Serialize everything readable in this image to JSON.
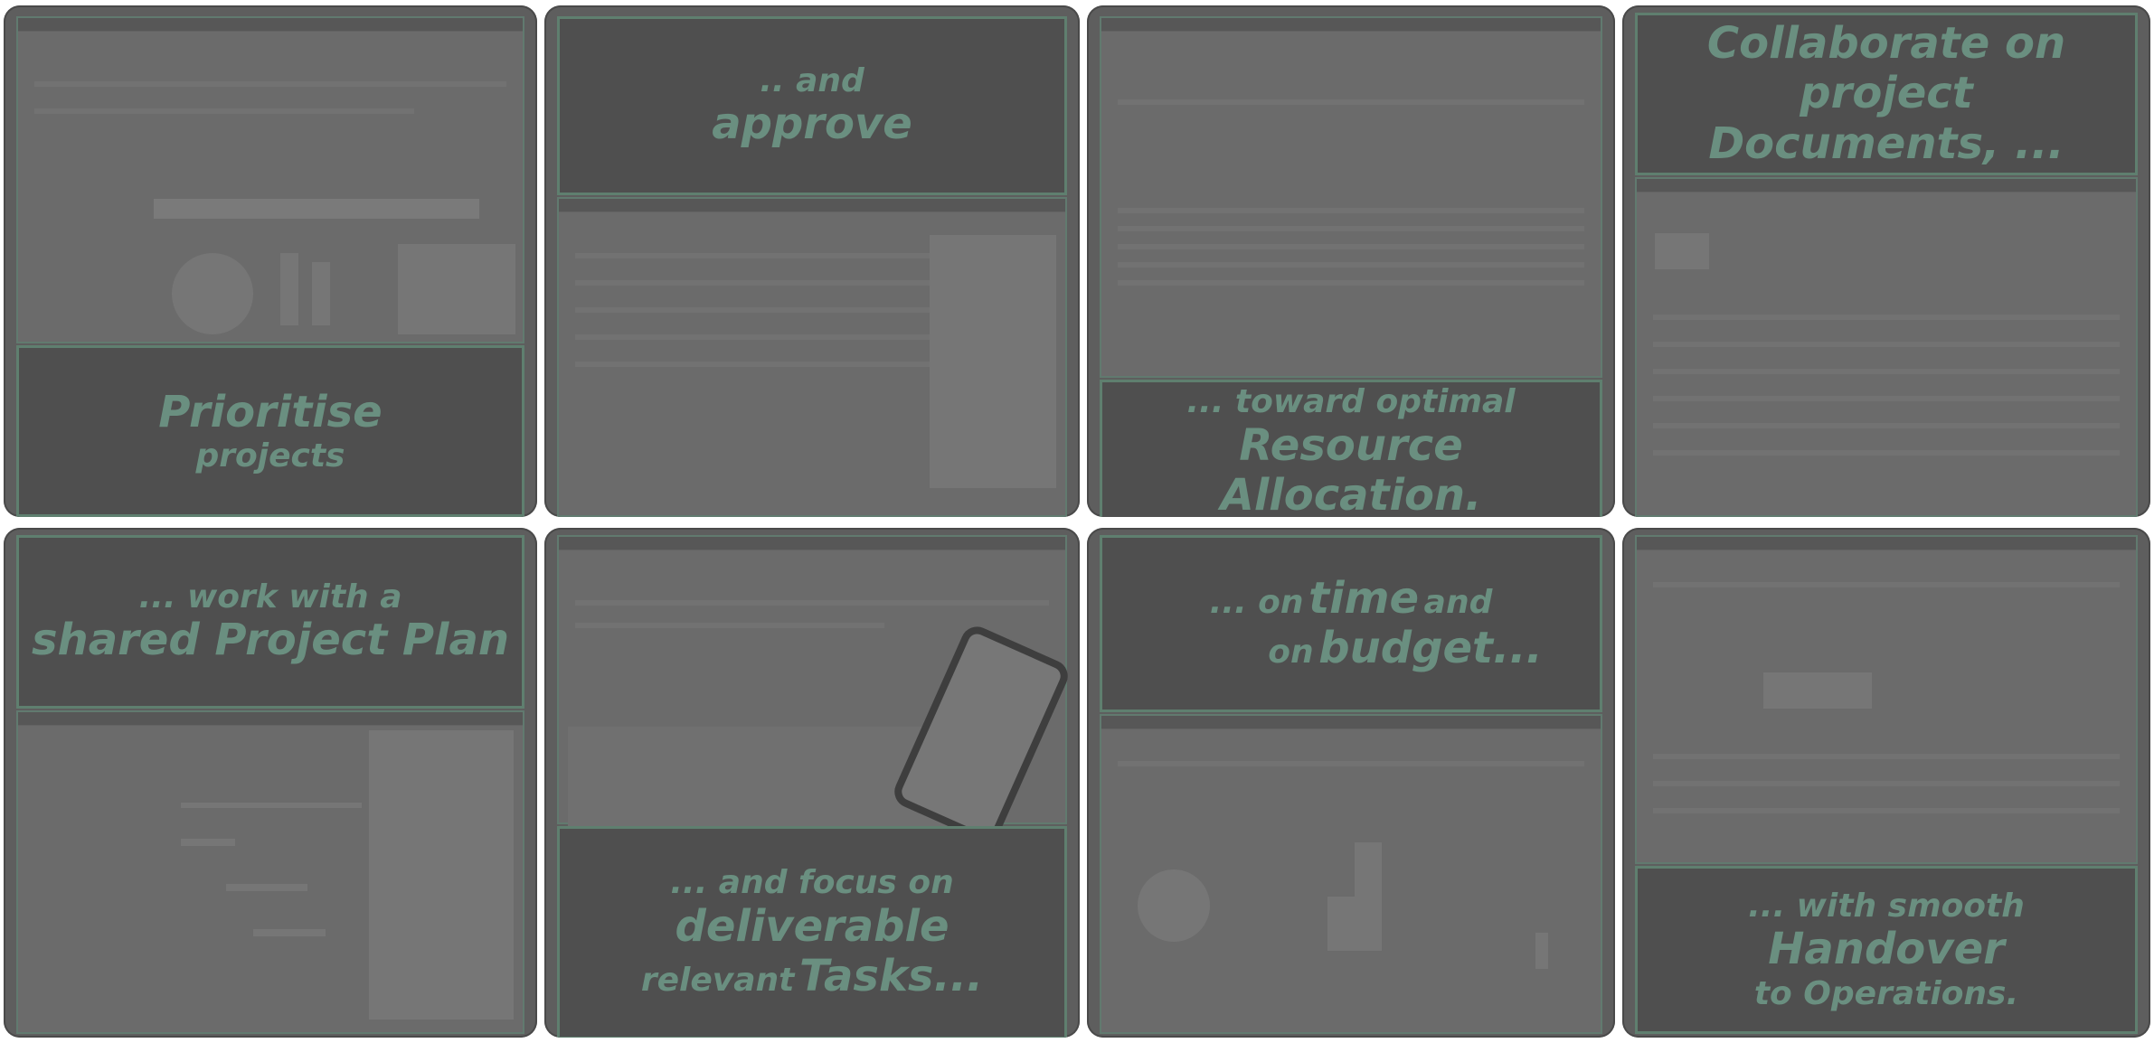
{
  "tiles": [
    {
      "id": "prioritise",
      "l1": "Prioritise",
      "l2": "projects"
    },
    {
      "id": "approve",
      "l1": ".. and",
      "l2": "approve"
    },
    {
      "id": "resource",
      "l1": "... toward optimal",
      "l2": "Resource Allocation."
    },
    {
      "id": "collaborate",
      "l1": "Collaborate on project",
      "l2": "Documents, ..."
    },
    {
      "id": "shared-plan",
      "l1": "... work with a",
      "l2": "shared Project Plan"
    },
    {
      "id": "tasks",
      "l1a": "... and focus on",
      "l1b": "deliverable",
      "l2a": "relevant",
      "l2b": "Tasks..."
    },
    {
      "id": "time-budget",
      "l1a": "... on",
      "l1b": "time",
      "l1c": "and",
      "l2a": "on",
      "l2b": "budget..."
    },
    {
      "id": "handover",
      "l1a": "... with smooth",
      "l1b": "Handover",
      "l2": "to Operations."
    }
  ]
}
